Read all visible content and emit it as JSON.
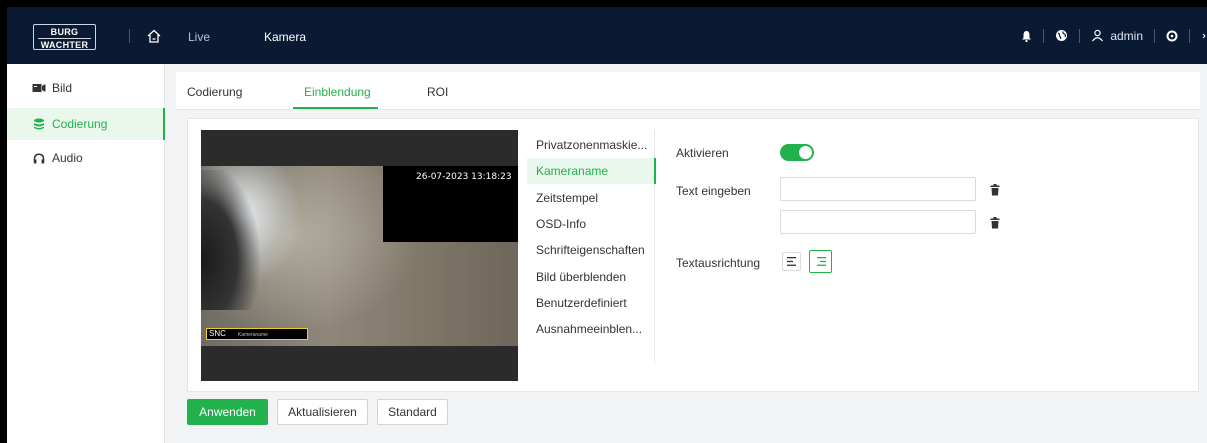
{
  "header": {
    "logo": {
      "line1": "BURG",
      "line2": "WACHTER"
    },
    "nav": {
      "live": "Live",
      "kamera": "Kamera"
    },
    "user": "admin",
    "icons": [
      "home-icon",
      "bell-icon",
      "globe-icon",
      "user-icon",
      "settings-icon",
      "logout-icon"
    ]
  },
  "sidebar": {
    "items": [
      {
        "label": "Bild",
        "icon": "image-icon"
      },
      {
        "label": "Codierung",
        "icon": "stack-icon",
        "active": true
      },
      {
        "label": "Audio",
        "icon": "headphones-icon"
      }
    ]
  },
  "tabs": [
    {
      "label": "Codierung"
    },
    {
      "label": "Einblendung",
      "active": true
    },
    {
      "label": "ROI"
    }
  ],
  "video": {
    "timestamp": "26-07-2023 13:18:23",
    "osd_name": "SNC",
    "osd_name_small": "Kameraname"
  },
  "submenu": [
    {
      "label": "Privatzonenmaskie..."
    },
    {
      "label": "Kameraname",
      "active": true
    },
    {
      "label": "Zeitstempel"
    },
    {
      "label": "OSD-Info"
    },
    {
      "label": "Schrifteigenschaften"
    },
    {
      "label": "Bild überblenden"
    },
    {
      "label": "Benutzerdefiniert"
    },
    {
      "label": "Ausnahmeeinblen..."
    }
  ],
  "form": {
    "activate_label": "Aktivieren",
    "activate_on": true,
    "text_label": "Text eingeben",
    "text_value_1": "",
    "text_value_2": "",
    "alignment_label": "Textausrichtung",
    "alignment_selected": "right"
  },
  "buttons": {
    "apply": "Anwenden",
    "refresh": "Aktualisieren",
    "default": "Standard"
  },
  "colors": {
    "accent": "#22b14c",
    "header_bg": "#0b1a33"
  }
}
